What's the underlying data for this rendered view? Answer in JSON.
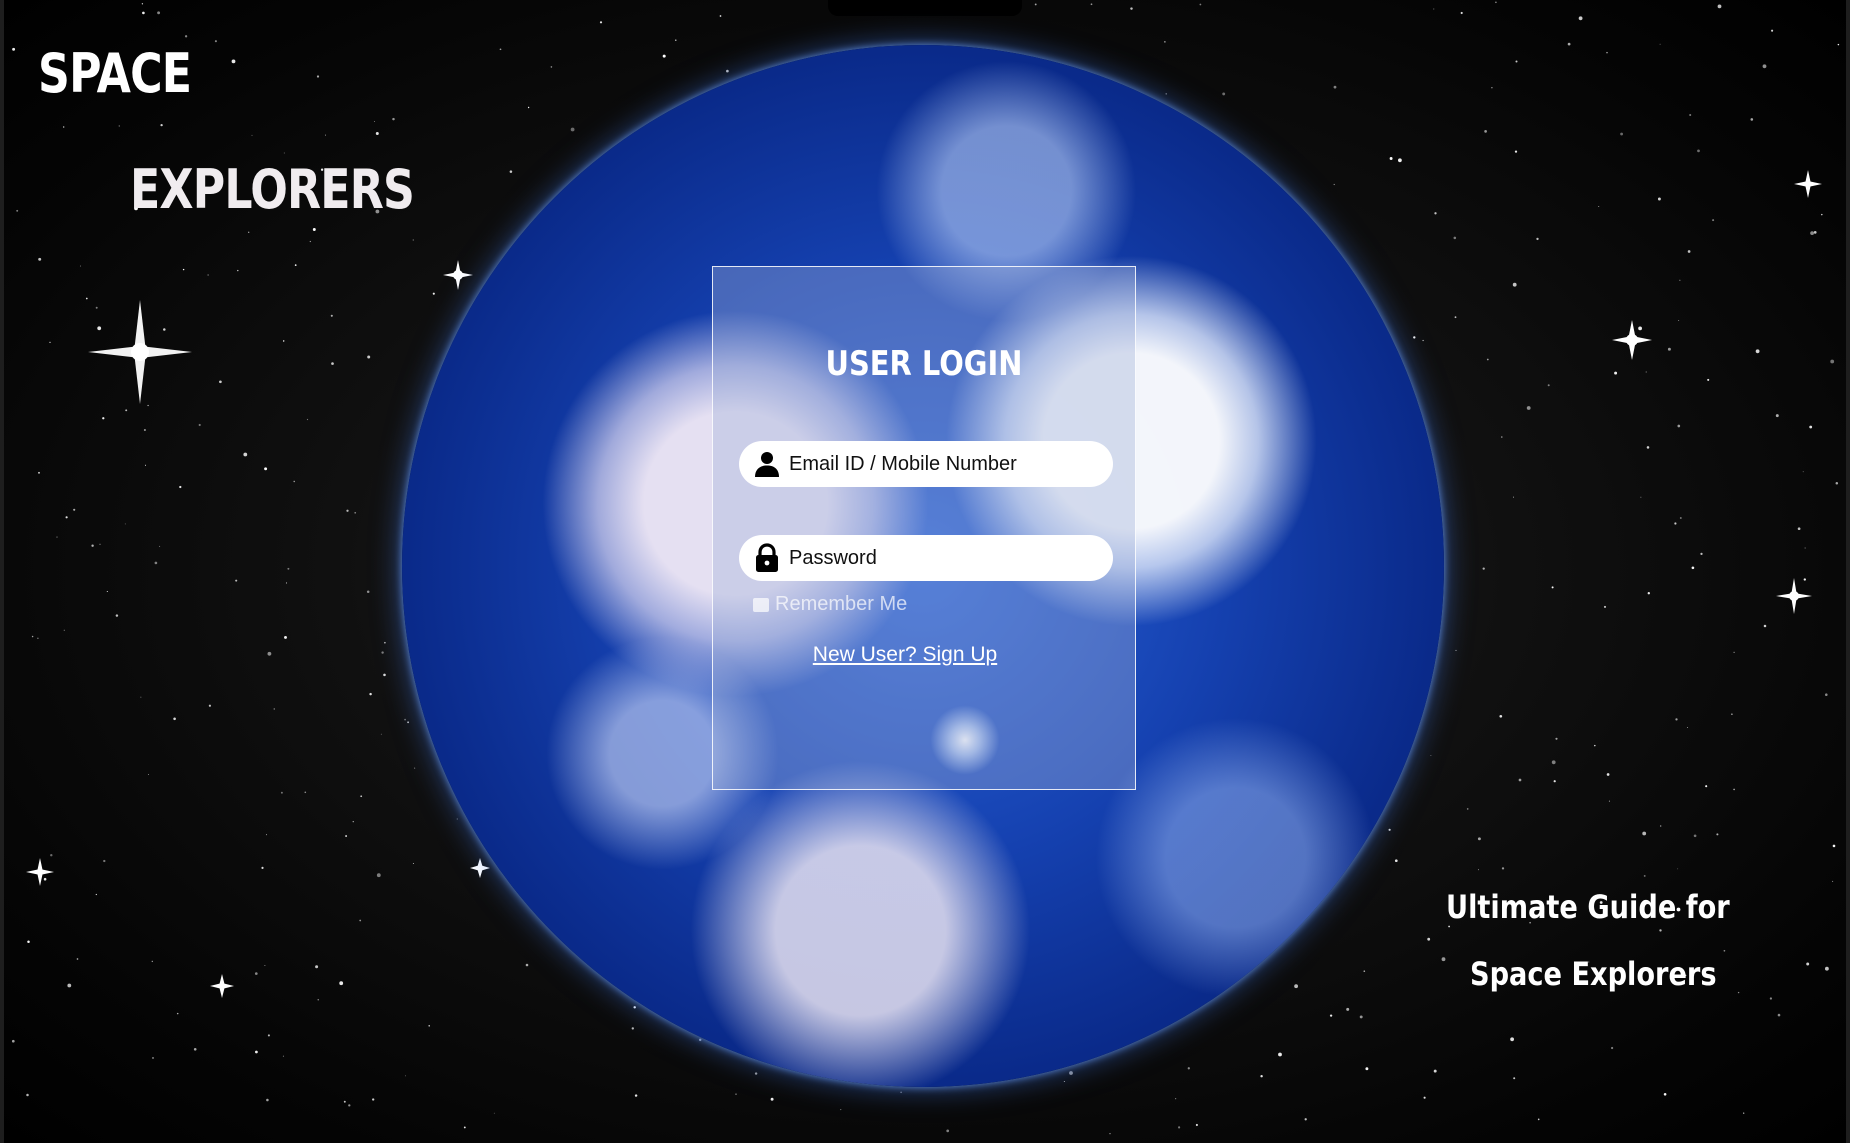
{
  "brand": {
    "line1": "SPACE",
    "line2": "EXPLORERS"
  },
  "tagline": {
    "line1": "Ultimate Guide for",
    "line2": "Space Explorers"
  },
  "login": {
    "title": "USER LOGIN",
    "email": {
      "placeholder": "Email ID / Mobile Number",
      "icon": "user-icon"
    },
    "password": {
      "placeholder": "Password",
      "icon": "lock-icon"
    },
    "remember_label": "Remember Me",
    "signup_link": "New User? Sign Up"
  },
  "colors": {
    "background": "#000000",
    "globe_blue": "#1541b0",
    "text": "#ffffff"
  }
}
